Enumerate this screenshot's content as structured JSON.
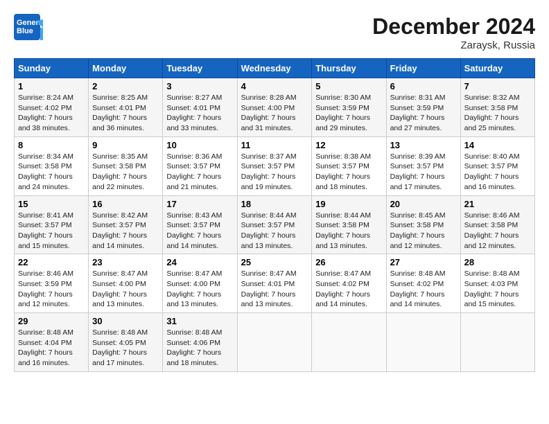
{
  "header": {
    "logo_line1": "General",
    "logo_line2": "Blue",
    "month": "December 2024",
    "location": "Zaraysk, Russia"
  },
  "weekdays": [
    "Sunday",
    "Monday",
    "Tuesday",
    "Wednesday",
    "Thursday",
    "Friday",
    "Saturday"
  ],
  "weeks": [
    [
      {
        "day": "1",
        "sunrise": "Sunrise: 8:24 AM",
        "sunset": "Sunset: 4:02 PM",
        "daylight": "Daylight: 7 hours and 38 minutes."
      },
      {
        "day": "2",
        "sunrise": "Sunrise: 8:25 AM",
        "sunset": "Sunset: 4:01 PM",
        "daylight": "Daylight: 7 hours and 36 minutes."
      },
      {
        "day": "3",
        "sunrise": "Sunrise: 8:27 AM",
        "sunset": "Sunset: 4:01 PM",
        "daylight": "Daylight: 7 hours and 33 minutes."
      },
      {
        "day": "4",
        "sunrise": "Sunrise: 8:28 AM",
        "sunset": "Sunset: 4:00 PM",
        "daylight": "Daylight: 7 hours and 31 minutes."
      },
      {
        "day": "5",
        "sunrise": "Sunrise: 8:30 AM",
        "sunset": "Sunset: 3:59 PM",
        "daylight": "Daylight: 7 hours and 29 minutes."
      },
      {
        "day": "6",
        "sunrise": "Sunrise: 8:31 AM",
        "sunset": "Sunset: 3:59 PM",
        "daylight": "Daylight: 7 hours and 27 minutes."
      },
      {
        "day": "7",
        "sunrise": "Sunrise: 8:32 AM",
        "sunset": "Sunset: 3:58 PM",
        "daylight": "Daylight: 7 hours and 25 minutes."
      }
    ],
    [
      {
        "day": "8",
        "sunrise": "Sunrise: 8:34 AM",
        "sunset": "Sunset: 3:58 PM",
        "daylight": "Daylight: 7 hours and 24 minutes."
      },
      {
        "day": "9",
        "sunrise": "Sunrise: 8:35 AM",
        "sunset": "Sunset: 3:58 PM",
        "daylight": "Daylight: 7 hours and 22 minutes."
      },
      {
        "day": "10",
        "sunrise": "Sunrise: 8:36 AM",
        "sunset": "Sunset: 3:57 PM",
        "daylight": "Daylight: 7 hours and 21 minutes."
      },
      {
        "day": "11",
        "sunrise": "Sunrise: 8:37 AM",
        "sunset": "Sunset: 3:57 PM",
        "daylight": "Daylight: 7 hours and 19 minutes."
      },
      {
        "day": "12",
        "sunrise": "Sunrise: 8:38 AM",
        "sunset": "Sunset: 3:57 PM",
        "daylight": "Daylight: 7 hours and 18 minutes."
      },
      {
        "day": "13",
        "sunrise": "Sunrise: 8:39 AM",
        "sunset": "Sunset: 3:57 PM",
        "daylight": "Daylight: 7 hours and 17 minutes."
      },
      {
        "day": "14",
        "sunrise": "Sunrise: 8:40 AM",
        "sunset": "Sunset: 3:57 PM",
        "daylight": "Daylight: 7 hours and 16 minutes."
      }
    ],
    [
      {
        "day": "15",
        "sunrise": "Sunrise: 8:41 AM",
        "sunset": "Sunset: 3:57 PM",
        "daylight": "Daylight: 7 hours and 15 minutes."
      },
      {
        "day": "16",
        "sunrise": "Sunrise: 8:42 AM",
        "sunset": "Sunset: 3:57 PM",
        "daylight": "Daylight: 7 hours and 14 minutes."
      },
      {
        "day": "17",
        "sunrise": "Sunrise: 8:43 AM",
        "sunset": "Sunset: 3:57 PM",
        "daylight": "Daylight: 7 hours and 14 minutes."
      },
      {
        "day": "18",
        "sunrise": "Sunrise: 8:44 AM",
        "sunset": "Sunset: 3:57 PM",
        "daylight": "Daylight: 7 hours and 13 minutes."
      },
      {
        "day": "19",
        "sunrise": "Sunrise: 8:44 AM",
        "sunset": "Sunset: 3:58 PM",
        "daylight": "Daylight: 7 hours and 13 minutes."
      },
      {
        "day": "20",
        "sunrise": "Sunrise: 8:45 AM",
        "sunset": "Sunset: 3:58 PM",
        "daylight": "Daylight: 7 hours and 12 minutes."
      },
      {
        "day": "21",
        "sunrise": "Sunrise: 8:46 AM",
        "sunset": "Sunset: 3:58 PM",
        "daylight": "Daylight: 7 hours and 12 minutes."
      }
    ],
    [
      {
        "day": "22",
        "sunrise": "Sunrise: 8:46 AM",
        "sunset": "Sunset: 3:59 PM",
        "daylight": "Daylight: 7 hours and 12 minutes."
      },
      {
        "day": "23",
        "sunrise": "Sunrise: 8:47 AM",
        "sunset": "Sunset: 4:00 PM",
        "daylight": "Daylight: 7 hours and 13 minutes."
      },
      {
        "day": "24",
        "sunrise": "Sunrise: 8:47 AM",
        "sunset": "Sunset: 4:00 PM",
        "daylight": "Daylight: 7 hours and 13 minutes."
      },
      {
        "day": "25",
        "sunrise": "Sunrise: 8:47 AM",
        "sunset": "Sunset: 4:01 PM",
        "daylight": "Daylight: 7 hours and 13 minutes."
      },
      {
        "day": "26",
        "sunrise": "Sunrise: 8:47 AM",
        "sunset": "Sunset: 4:02 PM",
        "daylight": "Daylight: 7 hours and 14 minutes."
      },
      {
        "day": "27",
        "sunrise": "Sunrise: 8:48 AM",
        "sunset": "Sunset: 4:02 PM",
        "daylight": "Daylight: 7 hours and 14 minutes."
      },
      {
        "day": "28",
        "sunrise": "Sunrise: 8:48 AM",
        "sunset": "Sunset: 4:03 PM",
        "daylight": "Daylight: 7 hours and 15 minutes."
      }
    ],
    [
      {
        "day": "29",
        "sunrise": "Sunrise: 8:48 AM",
        "sunset": "Sunset: 4:04 PM",
        "daylight": "Daylight: 7 hours and 16 minutes."
      },
      {
        "day": "30",
        "sunrise": "Sunrise: 8:48 AM",
        "sunset": "Sunset: 4:05 PM",
        "daylight": "Daylight: 7 hours and 17 minutes."
      },
      {
        "day": "31",
        "sunrise": "Sunrise: 8:48 AM",
        "sunset": "Sunset: 4:06 PM",
        "daylight": "Daylight: 7 hours and 18 minutes."
      },
      null,
      null,
      null,
      null
    ]
  ]
}
